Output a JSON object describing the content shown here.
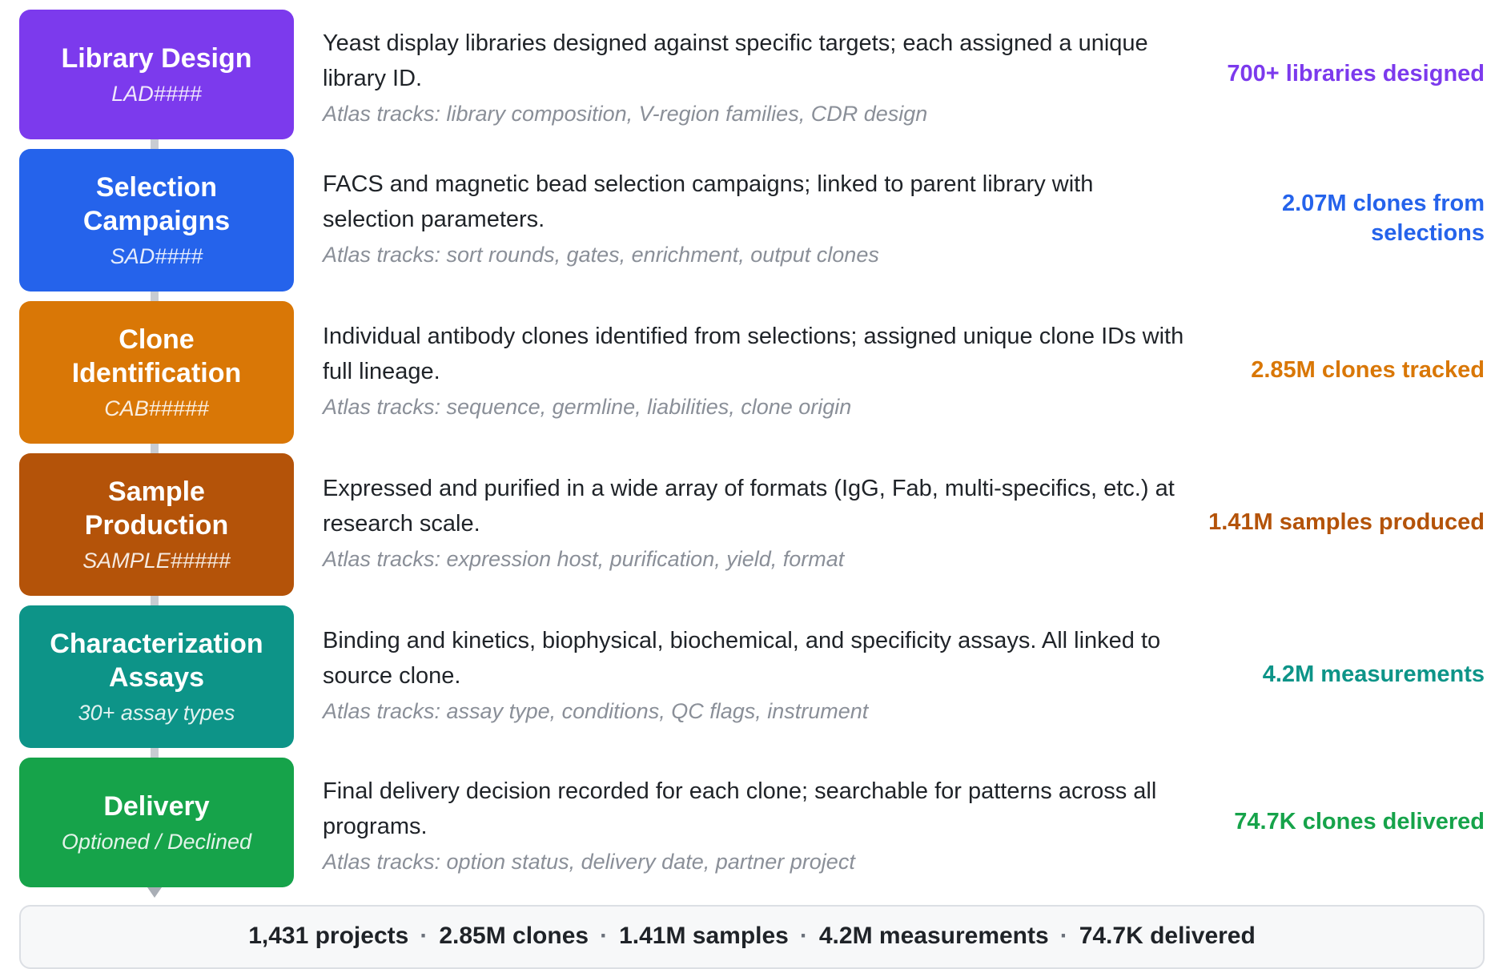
{
  "stages": [
    {
      "title": "Library Design",
      "code": "LAD####",
      "description": "Yeast display libraries designed against specific targets; each assigned a unique library ID.",
      "tracks": "Atlas tracks: library composition, V-region families, CDR design",
      "metric": "700+ libraries designed",
      "color": "#7c3aed"
    },
    {
      "title": "Selection\nCampaigns",
      "code": "SAD####",
      "description": "FACS and magnetic bead selection campaigns; linked to parent library with selection parameters.",
      "tracks": "Atlas tracks: sort rounds, gates, enrichment, output clones",
      "metric": "2.07M clones from\nselections",
      "color": "#2563eb"
    },
    {
      "title": "Clone\nIdentification",
      "code": "CAB#####",
      "description": "Individual antibody clones identified from selections; assigned unique clone IDs with full lineage.",
      "tracks": "Atlas tracks: sequence, germline, liabilities, clone origin",
      "metric": "2.85M clones tracked",
      "color": "#d97706"
    },
    {
      "title": "Sample\nProduction",
      "code": "SAMPLE#####",
      "description": "Expressed and purified in a wide array of formats (IgG, Fab, multi-specifics, etc.) at research scale.",
      "tracks": "Atlas tracks: expression host, purification, yield, format",
      "metric": "1.41M samples produced",
      "color": "#b45309"
    },
    {
      "title": "Characterization\nAssays",
      "code": "30+ assay types",
      "description": "Binding and kinetics, biophysical, biochemical, and specificity assays. All linked to source clone.",
      "tracks": "Atlas tracks: assay type, conditions, QC flags, instrument",
      "metric": "4.2M measurements",
      "color": "#0d9488"
    },
    {
      "title": "Delivery",
      "code": "Optioned / Declined",
      "description": "Final delivery decision recorded for each clone; searchable for patterns across all programs.",
      "tracks": "Atlas tracks: option status, delivery date, partner project",
      "metric": "74.7K clones delivered",
      "color": "#16a34a"
    }
  ],
  "summary": {
    "projects": "1,431 projects",
    "clones": "2.85M clones",
    "samples": "1.41M samples",
    "measurements": "4.2M measurements",
    "delivered": "74.7K delivered",
    "separator": "·"
  }
}
